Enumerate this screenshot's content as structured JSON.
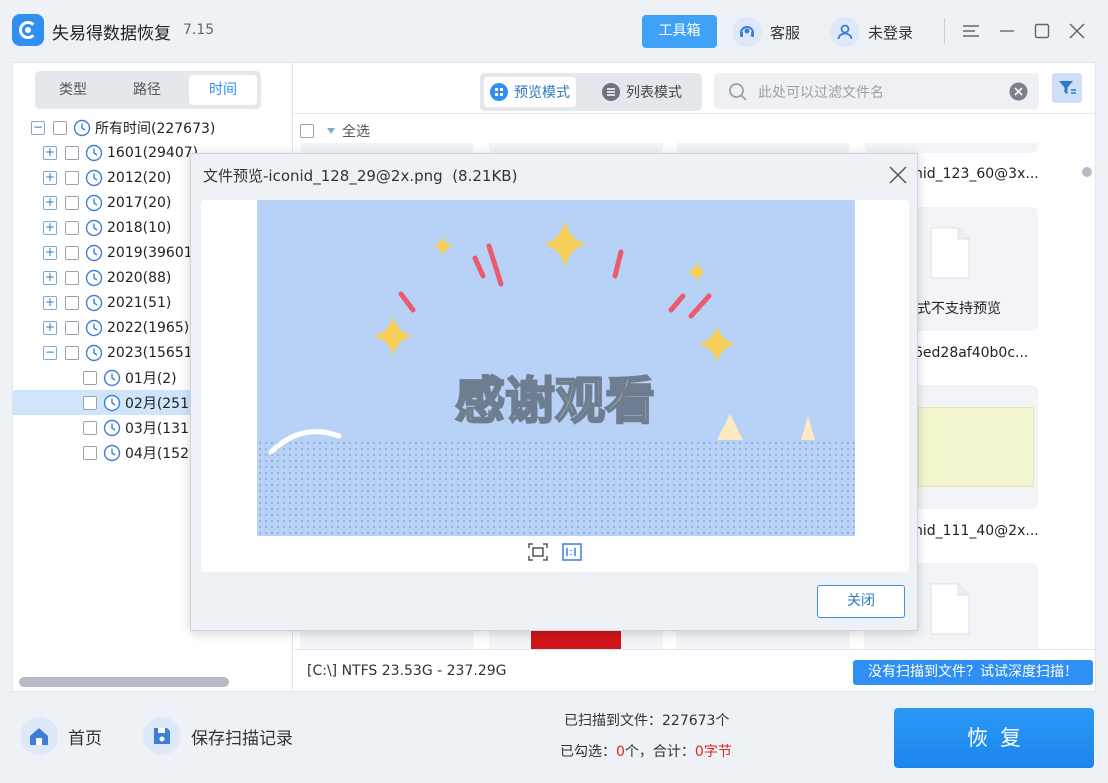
{
  "app": {
    "title": "失易得数据恢复",
    "version": "7.15"
  },
  "titlebar": {
    "toolbox": "工具箱",
    "service": "客服",
    "login": "未登录"
  },
  "left_tabs": [
    "类型",
    "路径",
    "时间"
  ],
  "tree": [
    {
      "label": "所有时间(227673)",
      "level": 0,
      "expander": "−"
    },
    {
      "label": "1601(29407)",
      "level": 1,
      "expander": "+"
    },
    {
      "label": "2012(20)",
      "level": 1,
      "expander": "+"
    },
    {
      "label": "2017(20)",
      "level": 1,
      "expander": "+"
    },
    {
      "label": "2018(10)",
      "level": 1,
      "expander": "+"
    },
    {
      "label": "2019(39601",
      "level": 1,
      "expander": "+"
    },
    {
      "label": "2020(88)",
      "level": 1,
      "expander": "+"
    },
    {
      "label": "2021(51)",
      "level": 1,
      "expander": "+"
    },
    {
      "label": "2022(1965)",
      "level": 1,
      "expander": "+"
    },
    {
      "label": "2023(15651",
      "level": 1,
      "expander": "−"
    },
    {
      "label": "01月(2)",
      "level": 2
    },
    {
      "label": "02月(251",
      "level": 2,
      "selected": true
    },
    {
      "label": "03月(131",
      "level": 2
    },
    {
      "label": "04月(152",
      "level": 2
    }
  ],
  "view_modes": {
    "preview": "预览模式",
    "list": "列表模式"
  },
  "search": {
    "placeholder": "此处可以过滤文件名"
  },
  "select_all": "全选",
  "files": {
    "name_1": "nid_123_60@3x...",
    "unsupported": "式不支持预览",
    "name_2": "6ed28af40b0c...",
    "name_3": "nid_111_40@2x..."
  },
  "status": {
    "disk": "[C:\\] NTFS 23.53G - 237.29G",
    "deep_scan": "没有扫描到文件？试试深度扫描！"
  },
  "bottom": {
    "home": "首页",
    "save_scan": "保存扫描记录",
    "scanned_label": "已扫描到文件：",
    "scanned_count": "227673个",
    "selected_label": "已勾选：",
    "selected_count": "0",
    "selected_mid": "个，合计：",
    "selected_size": "0字节",
    "recover": "恢复"
  },
  "dialog": {
    "title": "文件预览-iconid_128_29@2x.png",
    "size": "(8.21KB)",
    "image_text": "感谢观看",
    "close": "关闭"
  },
  "colors": {
    "accent": "#2f8ff2",
    "preview_bg": "#b7d2f6",
    "star": "#f5cf5a",
    "dash": "#ec5a6d"
  }
}
